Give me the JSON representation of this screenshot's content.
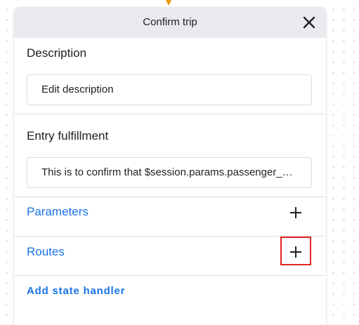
{
  "panel": {
    "title": "Confirm trip",
    "close_icon": "close-icon"
  },
  "description": {
    "heading": "Description",
    "value": "Edit description"
  },
  "entry_fulfillment": {
    "heading": "Entry fulfillment",
    "value": "This is to confirm that $session.params.passenger_name"
  },
  "parameters": {
    "label": "Parameters",
    "add_icon": "plus-icon"
  },
  "routes": {
    "label": "Routes",
    "add_icon": "plus-icon"
  },
  "add_state_handler": {
    "label": "Add state handler"
  },
  "colors": {
    "link": "#1a73e8",
    "header_bg": "#e8eaed",
    "highlight": "#e02424",
    "connector": "#f29900"
  }
}
